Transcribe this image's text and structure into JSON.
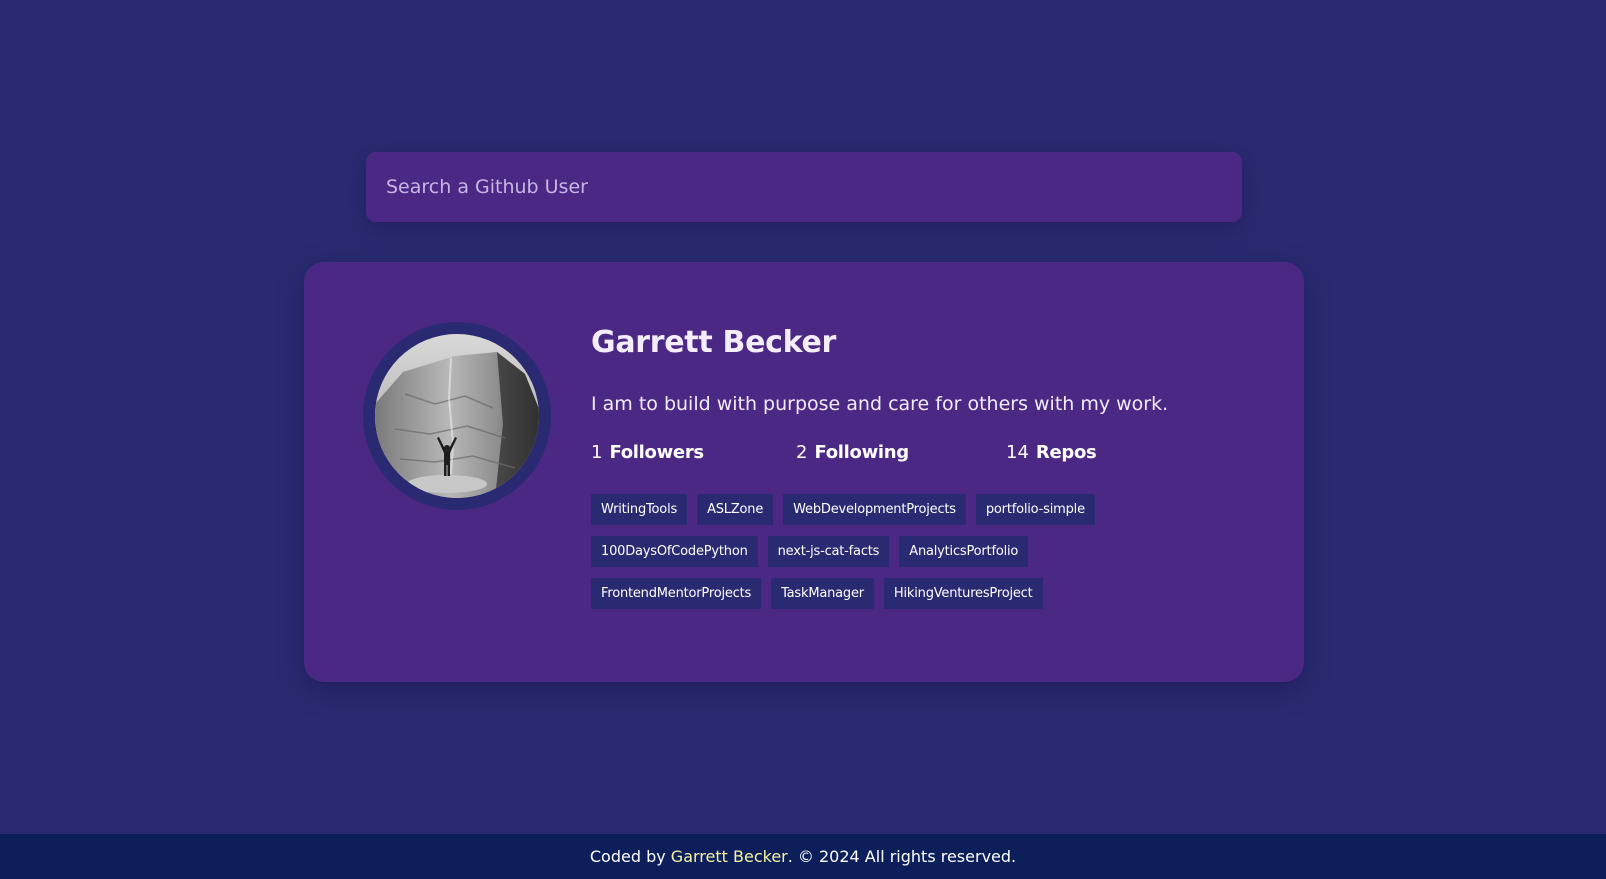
{
  "search": {
    "placeholder": "Search a Github User",
    "value": ""
  },
  "profile": {
    "name": "Garrett Becker",
    "bio": "I am to build with purpose and care for others with my work.",
    "avatar_icon": "profile-photo-climber-on-rock",
    "stats": {
      "followers_value": "1",
      "followers_label": "Followers",
      "following_value": "2",
      "following_label": "Following",
      "repos_value": "14",
      "repos_label": "Repos"
    },
    "repos": [
      "WritingTools",
      "ASLZone",
      "WebDevelopmentProjects",
      "portfolio-simple",
      "100DaysOfCodePython",
      "next-js-cat-facts",
      "AnalyticsPortfolio",
      "FrontendMentorProjects",
      "TaskManager",
      "HikingVenturesProject"
    ]
  },
  "footer": {
    "prefix": "Coded by ",
    "author": "Garrett Becker",
    "suffix": ". © 2024 All rights reserved."
  },
  "colors": {
    "background": "#2a2a72",
    "card": "#4c2885",
    "tag": "#2a2a72",
    "footer": "#0d1f5b",
    "author_link": "#f7f3a0"
  }
}
